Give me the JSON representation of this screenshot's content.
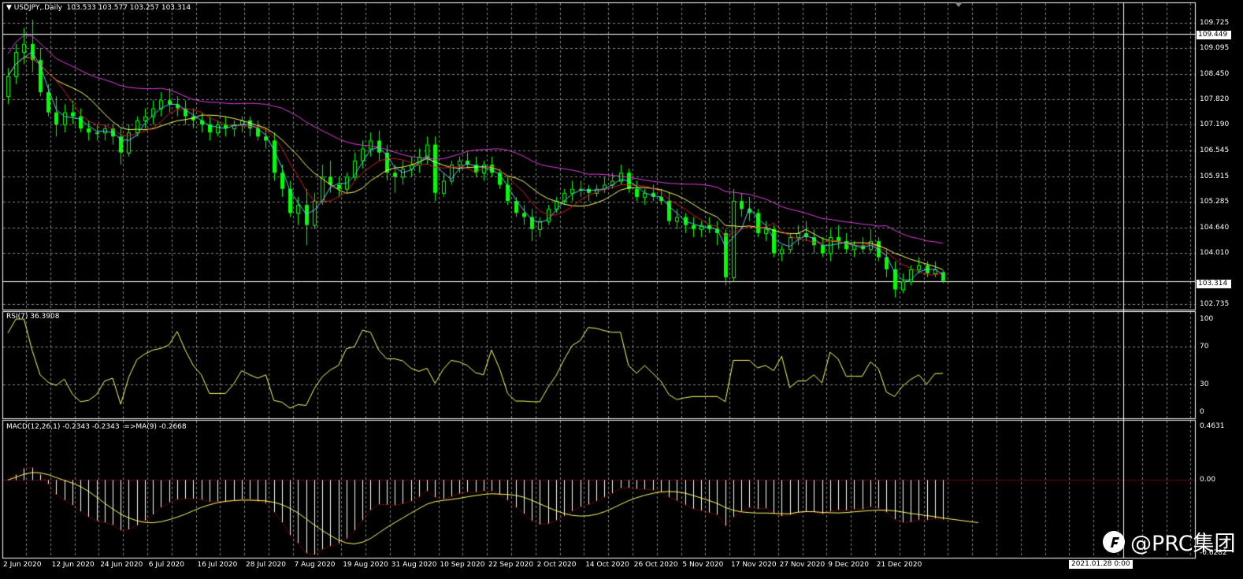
{
  "main": {
    "title_arrow": "▼",
    "title": "USDJPY,.Daily  103.533 103.577 103.257 103.314",
    "price_labels": [
      "109.725",
      "109.095",
      "108.450",
      "107.820",
      "107.190",
      "106.545",
      "105.915",
      "105.285",
      "104.640",
      "104.010",
      "102.735"
    ],
    "current_price": "103.314",
    "level_price": "109.449"
  },
  "rsi": {
    "title": "RSI(7) 36.3908",
    "levels": [
      "100",
      "70",
      "30",
      "0"
    ]
  },
  "macd": {
    "title": "MACD(12,26,1) -0.2343 -0.2343  =>MA(9) -0.2668",
    "levels": [
      "0.4631",
      "0.00",
      "-0.6282"
    ]
  },
  "xaxis": {
    "labels": [
      "2 Jun 2020",
      "12 Jun 2020",
      "24 Jun 2020",
      "6 Jul 2020",
      "16 Jul 2020",
      "28 Jul 2020",
      "7 Aug 2020",
      "19 Aug 2020",
      "31 Aug 2020",
      "10 Sep 2020",
      "22 Sep 2020",
      "2 Oct 2020",
      "14 Oct 2020",
      "26 Oct 2020",
      "5 Nov 2020",
      "17 Nov 2020",
      "27 Nov 2020",
      "9 Dec 2020",
      "21 Dec 2020"
    ],
    "cursor_time": "2021.01.28 0:00"
  },
  "watermark": {
    "text": "@PRC集团",
    "icon": "prc-logo-icon"
  },
  "colors": {
    "bull": "#00ff00",
    "bear": "#00ff00",
    "ma_fast": "#5fc9ff",
    "ma_mid": "#d21e1e",
    "ma_slow": "#ffff66",
    "ma_long": "#e040e0",
    "rsi_line": "#ffff66",
    "macd_signal": "#ffff66",
    "macd_hist": "#ffffff",
    "grid": "#c0c0c0"
  },
  "chart_data": {
    "type": "candlestick",
    "symbol": "USDJPY",
    "timeframe": "Daily",
    "ylim": [
      102.6,
      109.9
    ],
    "candles": [
      [
        107.9,
        108.6,
        107.7,
        108.4
      ],
      [
        108.4,
        109.2,
        108.2,
        109.0
      ],
      [
        109.0,
        109.6,
        108.7,
        109.2
      ],
      [
        109.2,
        109.8,
        108.5,
        108.8
      ],
      [
        108.8,
        109.1,
        107.9,
        108.0
      ],
      [
        108.0,
        108.2,
        107.4,
        107.5
      ],
      [
        107.5,
        107.9,
        106.9,
        107.2
      ],
      [
        107.2,
        107.7,
        107.0,
        107.5
      ],
      [
        107.5,
        107.8,
        107.2,
        107.4
      ],
      [
        107.4,
        107.6,
        107.0,
        107.1
      ],
      [
        107.1,
        107.3,
        106.8,
        107.0
      ],
      [
        107.0,
        107.2,
        106.8,
        107.0
      ],
      [
        107.0,
        107.2,
        106.8,
        107.1
      ],
      [
        107.1,
        107.2,
        106.7,
        106.9
      ],
      [
        106.9,
        107.1,
        106.2,
        106.5
      ],
      [
        106.5,
        107.2,
        106.4,
        107.0
      ],
      [
        107.0,
        107.4,
        106.9,
        107.3
      ],
      [
        107.3,
        107.6,
        107.1,
        107.4
      ],
      [
        107.4,
        107.8,
        107.2,
        107.6
      ],
      [
        107.6,
        108.0,
        107.4,
        107.8
      ],
      [
        107.8,
        108.1,
        107.5,
        107.7
      ],
      [
        107.7,
        107.9,
        107.4,
        107.6
      ],
      [
        107.6,
        107.8,
        107.2,
        107.4
      ],
      [
        107.4,
        107.6,
        107.1,
        107.3
      ],
      [
        107.3,
        107.5,
        107.0,
        107.2
      ],
      [
        107.2,
        107.4,
        106.8,
        107.0
      ],
      [
        107.0,
        107.3,
        106.9,
        107.2
      ],
      [
        107.2,
        107.4,
        106.9,
        107.1
      ],
      [
        107.1,
        107.3,
        106.9,
        107.2
      ],
      [
        107.2,
        107.4,
        107.0,
        107.3
      ],
      [
        107.3,
        107.4,
        106.9,
        107.1
      ],
      [
        107.1,
        107.3,
        106.8,
        106.9
      ],
      [
        106.9,
        107.1,
        106.6,
        106.8
      ],
      [
        106.8,
        107.0,
        105.8,
        106.0
      ],
      [
        106.0,
        106.2,
        105.4,
        105.6
      ],
      [
        105.6,
        105.8,
        104.9,
        105.0
      ],
      [
        105.0,
        105.4,
        104.7,
        105.2
      ],
      [
        105.2,
        105.6,
        104.2,
        104.7
      ],
      [
        104.7,
        105.5,
        104.6,
        105.3
      ],
      [
        105.3,
        106.2,
        105.2,
        105.9
      ],
      [
        105.9,
        106.3,
        105.5,
        105.7
      ],
      [
        105.7,
        105.9,
        105.4,
        105.6
      ],
      [
        105.6,
        106.0,
        105.5,
        105.9
      ],
      [
        105.9,
        106.5,
        105.8,
        106.3
      ],
      [
        106.3,
        106.8,
        106.1,
        106.6
      ],
      [
        106.6,
        107.0,
        106.4,
        106.8
      ],
      [
        106.8,
        107.05,
        106.3,
        106.5
      ],
      [
        106.5,
        106.7,
        105.8,
        106.0
      ],
      [
        106.0,
        106.2,
        105.5,
        105.9
      ],
      [
        105.9,
        106.3,
        105.7,
        106.1
      ],
      [
        106.1,
        106.4,
        105.9,
        106.2
      ],
      [
        106.2,
        106.6,
        106.0,
        106.4
      ],
      [
        106.4,
        106.9,
        106.2,
        106.7
      ],
      [
        106.7,
        106.9,
        105.3,
        105.5
      ],
      [
        105.5,
        106.0,
        105.4,
        105.8
      ],
      [
        105.8,
        106.3,
        105.7,
        106.2
      ],
      [
        106.2,
        106.4,
        106.0,
        106.3
      ],
      [
        106.3,
        106.5,
        106.1,
        106.2
      ],
      [
        106.2,
        106.4,
        105.9,
        106.0
      ],
      [
        106.0,
        106.3,
        105.8,
        106.2
      ],
      [
        106.2,
        106.4,
        105.9,
        106.0
      ],
      [
        106.0,
        106.1,
        105.6,
        105.7
      ],
      [
        105.7,
        105.9,
        105.2,
        105.3
      ],
      [
        105.3,
        105.4,
        104.9,
        105.0
      ],
      [
        105.0,
        105.2,
        104.7,
        104.9
      ],
      [
        104.9,
        105.1,
        104.3,
        104.6
      ],
      [
        104.6,
        104.9,
        104.4,
        104.8
      ],
      [
        104.8,
        105.2,
        104.7,
        105.1
      ],
      [
        105.1,
        105.4,
        105.0,
        105.3
      ],
      [
        105.3,
        105.6,
        105.2,
        105.5
      ],
      [
        105.5,
        105.8,
        105.3,
        105.6
      ],
      [
        105.6,
        105.8,
        105.4,
        105.6
      ],
      [
        105.6,
        105.7,
        105.3,
        105.5
      ],
      [
        105.5,
        105.7,
        105.4,
        105.6
      ],
      [
        105.6,
        105.9,
        105.5,
        105.7
      ],
      [
        105.7,
        106.0,
        105.6,
        105.8
      ],
      [
        105.8,
        106.2,
        105.7,
        106.0
      ],
      [
        106.0,
        106.1,
        105.5,
        105.6
      ],
      [
        105.6,
        105.8,
        105.3,
        105.4
      ],
      [
        105.4,
        105.6,
        105.2,
        105.5
      ],
      [
        105.5,
        105.7,
        105.3,
        105.4
      ],
      [
        105.4,
        105.6,
        105.2,
        105.3
      ],
      [
        105.3,
        105.5,
        104.7,
        104.8
      ],
      [
        104.8,
        105.1,
        104.6,
        104.9
      ],
      [
        104.9,
        105.0,
        104.5,
        104.7
      ],
      [
        104.7,
        104.9,
        104.4,
        104.6
      ],
      [
        104.6,
        104.8,
        104.4,
        104.7
      ],
      [
        104.7,
        104.9,
        104.5,
        104.6
      ],
      [
        104.6,
        104.8,
        104.2,
        104.5
      ],
      [
        104.5,
        104.6,
        103.2,
        103.4
      ],
      [
        103.4,
        105.6,
        103.3,
        105.3
      ],
      [
        105.3,
        105.5,
        104.9,
        105.1
      ],
      [
        105.1,
        105.4,
        104.8,
        105.0
      ],
      [
        105.0,
        105.1,
        104.4,
        104.5
      ],
      [
        104.5,
        104.8,
        104.3,
        104.6
      ],
      [
        104.6,
        104.7,
        103.9,
        104.0
      ],
      [
        104.0,
        104.2,
        103.8,
        104.1
      ],
      [
        104.1,
        104.5,
        104.0,
        104.4
      ],
      [
        104.4,
        104.7,
        104.2,
        104.5
      ],
      [
        104.5,
        104.8,
        104.3,
        104.4
      ],
      [
        104.4,
        104.6,
        104.0,
        104.2
      ],
      [
        104.2,
        104.4,
        103.9,
        104.0
      ],
      [
        104.0,
        104.6,
        103.8,
        104.4
      ],
      [
        104.4,
        104.7,
        104.1,
        104.3
      ],
      [
        104.3,
        104.5,
        104.0,
        104.1
      ],
      [
        104.1,
        104.3,
        103.9,
        104.2
      ],
      [
        104.2,
        104.4,
        104.0,
        104.1
      ],
      [
        104.1,
        104.6,
        104.0,
        104.3
      ],
      [
        104.3,
        104.4,
        103.8,
        103.9
      ],
      [
        103.9,
        104.1,
        103.4,
        103.6
      ],
      [
        103.6,
        103.8,
        102.9,
        103.1
      ],
      [
        103.1,
        103.5,
        103.0,
        103.3
      ],
      [
        103.3,
        103.7,
        103.2,
        103.6
      ],
      [
        103.6,
        103.9,
        103.5,
        103.7
      ],
      [
        103.7,
        103.8,
        103.4,
        103.5
      ],
      [
        103.5,
        103.8,
        103.4,
        103.6
      ],
      [
        103.533,
        103.577,
        103.257,
        103.314
      ]
    ]
  }
}
